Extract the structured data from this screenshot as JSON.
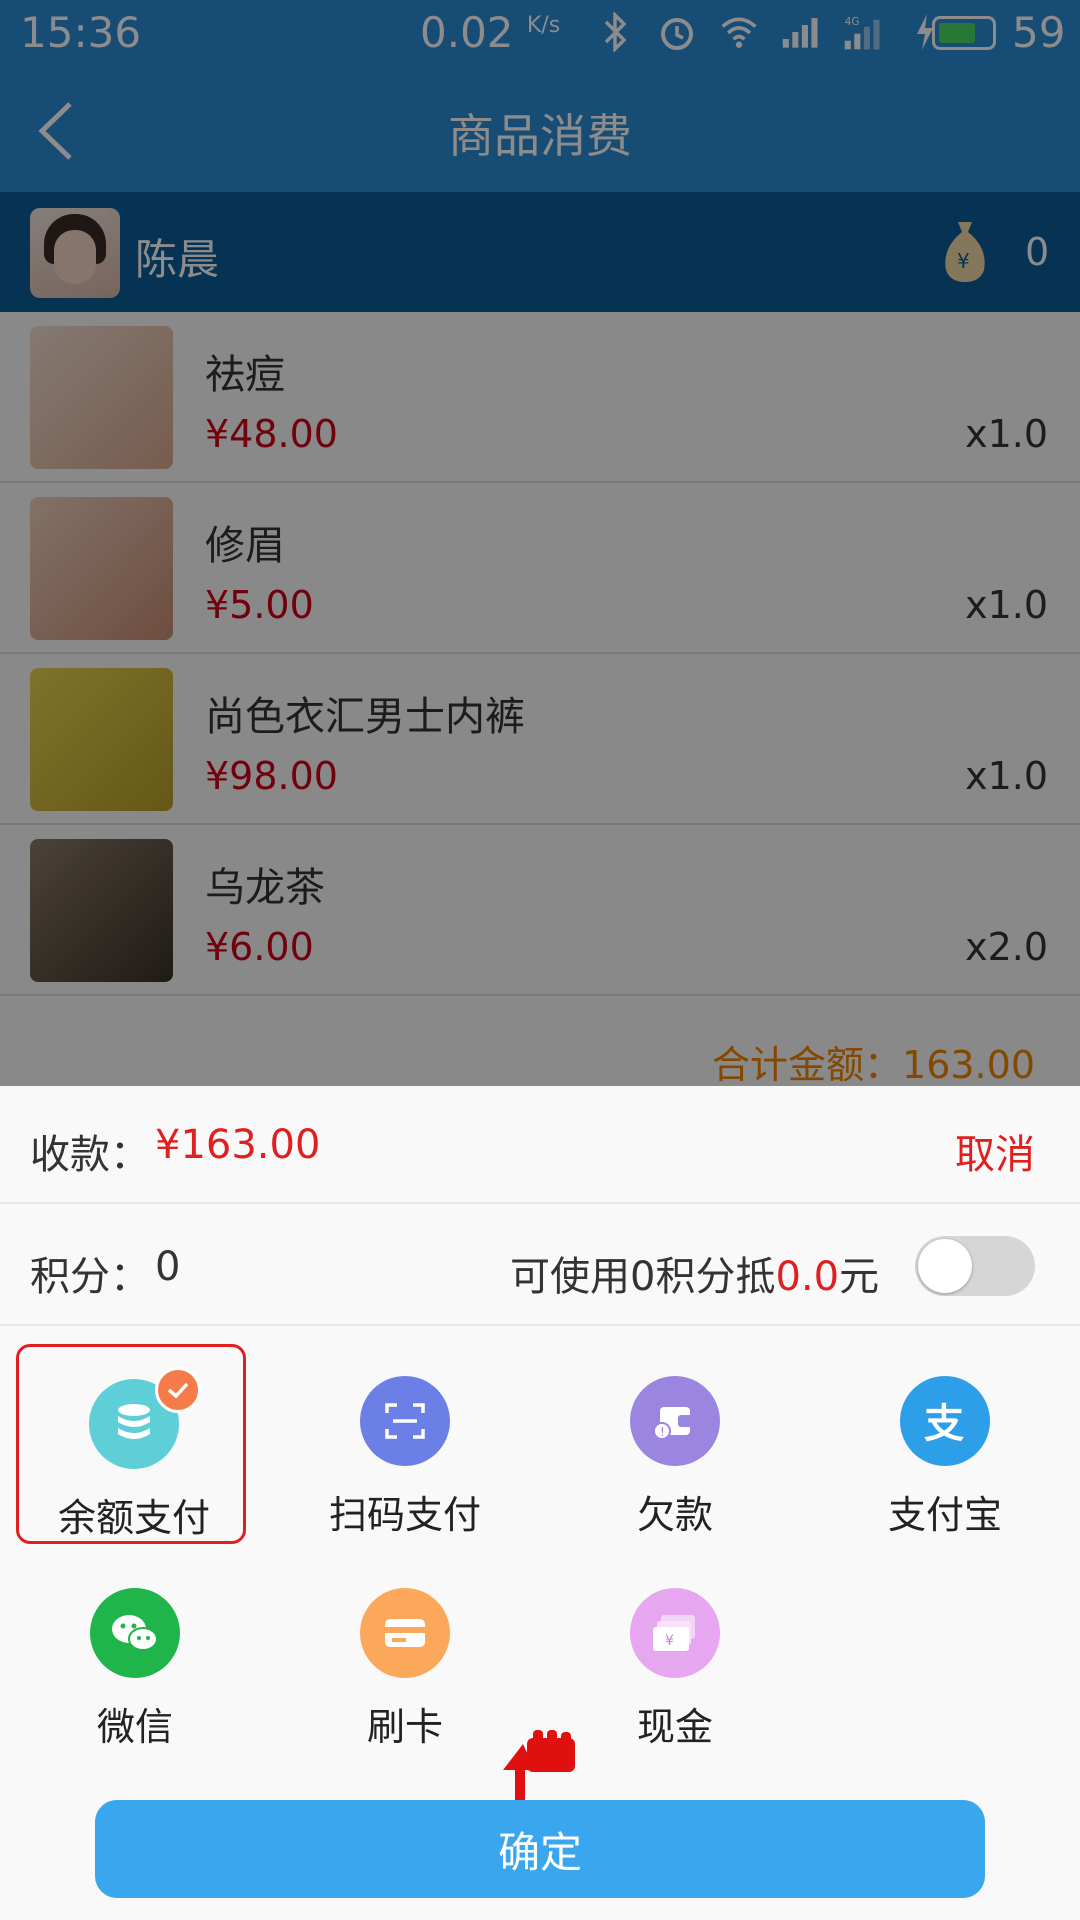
{
  "status_bar": {
    "time": "15:36",
    "speed": "0.02",
    "speed_unit": "K/s",
    "battery_level": "59"
  },
  "nav": {
    "title": "商品消费"
  },
  "member": {
    "name": "陈晨",
    "points": "0"
  },
  "items": [
    {
      "name": "祛痘",
      "price": "¥48.00",
      "qty": "x1.0"
    },
    {
      "name": "修眉",
      "price": "¥5.00",
      "qty": "x1.0"
    },
    {
      "name": "尚色衣汇男士内裤",
      "price": "¥98.00",
      "qty": "x1.0"
    },
    {
      "name": "乌龙茶",
      "price": "¥6.00",
      "qty": "x2.0"
    }
  ],
  "summary": {
    "total_text": "合计金额：163.00"
  },
  "sheet": {
    "pay_label": "收款：",
    "pay_amount": "¥163.00",
    "cancel": "取消",
    "points_label": "积分：",
    "points_value": "0",
    "points_desc_prefix": "可使用0积分抵",
    "points_desc_amount": "0.0",
    "points_desc_suffix": "元",
    "methods": [
      {
        "label": "余额支付",
        "icon": "database-icon",
        "color": "#5ecfd6",
        "selected": true
      },
      {
        "label": "扫码支付",
        "icon": "scan-icon",
        "color": "#6c7fe6"
      },
      {
        "label": "欠款",
        "icon": "wallet-icon",
        "color": "#9a86e0"
      },
      {
        "label": "支付宝",
        "icon": "alipay-icon",
        "color": "#2d9ee8"
      },
      {
        "label": "微信",
        "icon": "wechat-icon",
        "color": "#1fb54a"
      },
      {
        "label": "刷卡",
        "icon": "card-icon",
        "color": "#fba85a"
      },
      {
        "label": "现金",
        "icon": "cash-icon",
        "color": "#e6a6f0"
      }
    ],
    "confirm": "确定"
  }
}
